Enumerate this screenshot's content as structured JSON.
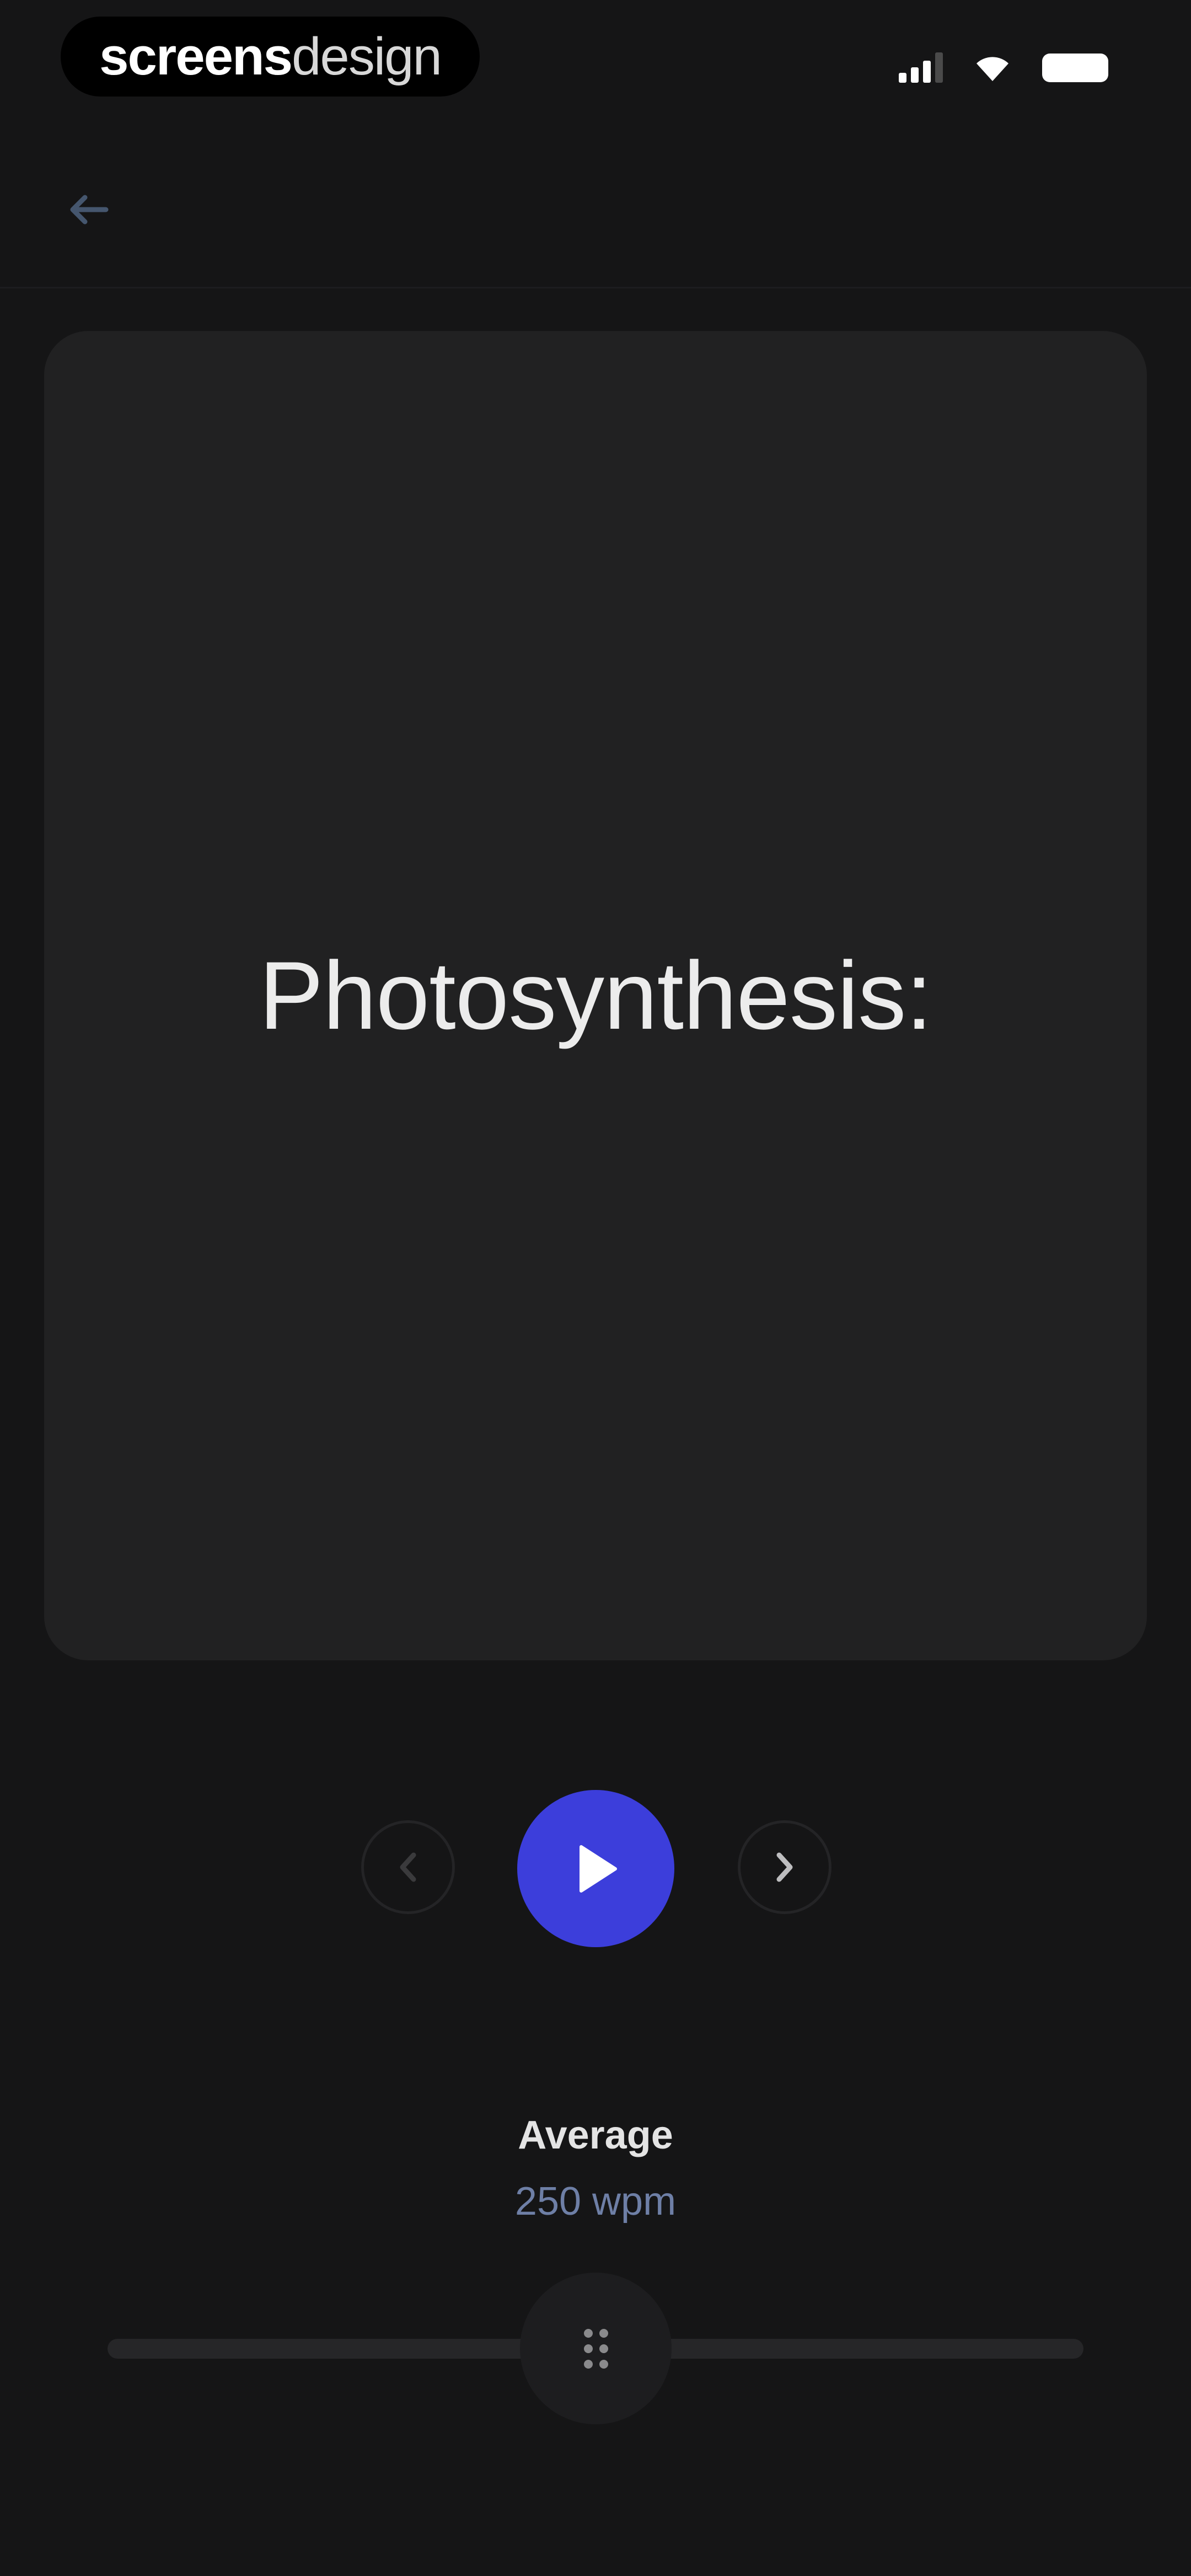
{
  "status_bar": {
    "brand_bold": "screens",
    "brand_light": "design",
    "icons": [
      "signal-icon",
      "wifi-icon",
      "battery-icon"
    ]
  },
  "header": {
    "back_icon": "arrow-left-icon"
  },
  "reader": {
    "current_word": "Photosynthesis:"
  },
  "controls": {
    "prev_icon": "chevron-left-icon",
    "play_icon": "play-icon",
    "next_icon": "chevron-right-icon"
  },
  "speed": {
    "label": "Average",
    "value": "250 wpm",
    "slider_level": 0.5,
    "thumb_icon": "grip-icon"
  },
  "colors": {
    "background": "#151516",
    "card": "#212122",
    "accent": "#3c3edb",
    "speed_value": "#6e7fa6"
  }
}
